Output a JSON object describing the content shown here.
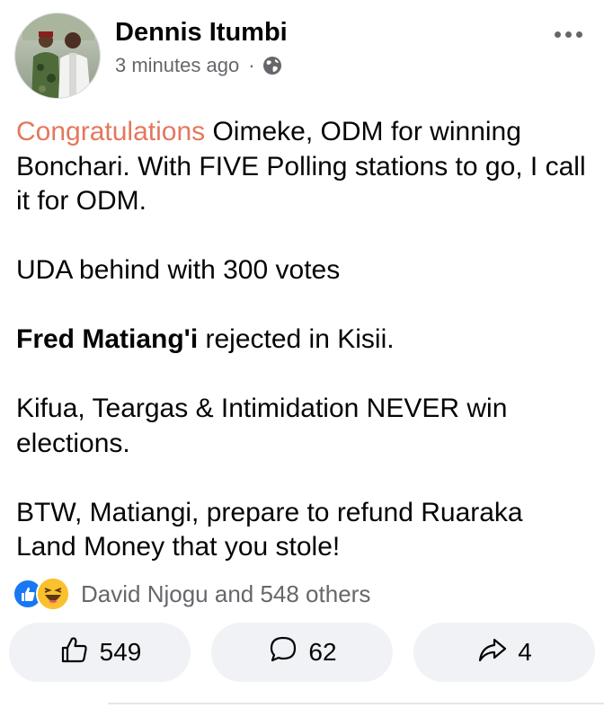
{
  "post": {
    "author": "Dennis Itumbi",
    "timestamp": "3 minutes ago",
    "separator": "·",
    "privacy_icon": "globe-icon",
    "more_icon": "more-horizontal-icon",
    "body": {
      "p1_highlight": "Congratulations",
      "p1_rest": " Oimeke, ODM for  winning Bonchari. With FIVE Polling stations to go, I call it for ODM.",
      "p2": "UDA behind with 300 votes",
      "p3_bold": "Fred Matiang'i",
      "p3_rest": "  rejected in Kisii.",
      "p4": "Kifua, Teargas & Intimidation NEVER win elections.",
      "p5": "BTW, Matiangi, prepare to refund Ruaraka Land Money that you stole!"
    },
    "reactions": {
      "icons": [
        "like-reaction-icon",
        "haha-reaction-icon"
      ],
      "summary": "David Njogu and 548 others"
    },
    "actions": {
      "like_count": "549",
      "comment_count": "62",
      "share_count": "4"
    }
  },
  "colors": {
    "accent": "#e4775d",
    "like_blue": "#1877f2",
    "secondary_text": "#65676b",
    "button_bg": "#f0f2f5"
  }
}
